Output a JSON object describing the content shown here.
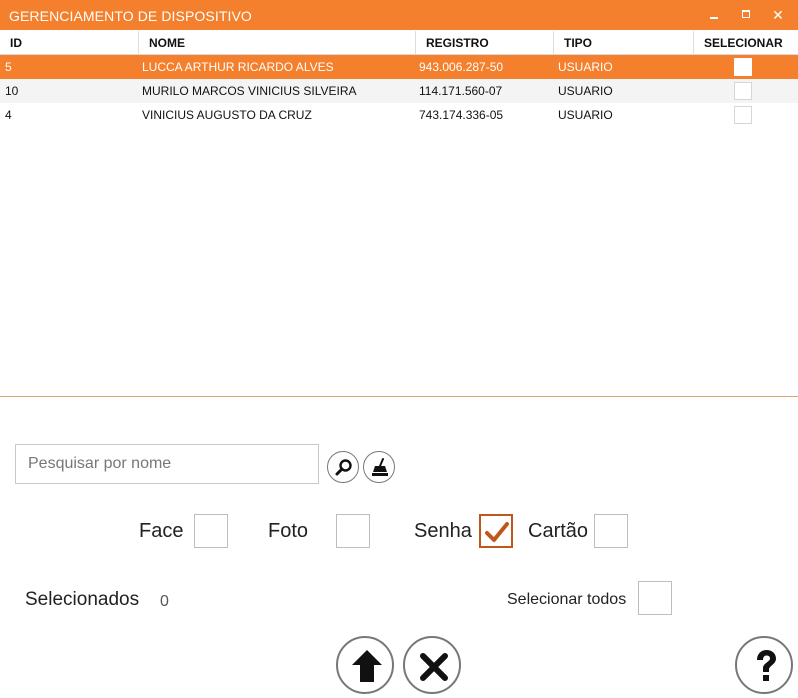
{
  "window": {
    "title": "GERENCIAMENTO DE DISPOSITIVO",
    "min_icon": "minimize-icon",
    "max_icon": "maximize-icon",
    "close_icon": "close-icon"
  },
  "table": {
    "columns": [
      "ID",
      "NOME",
      "REGISTRO",
      "TIPO",
      "SELECIONAR"
    ],
    "rows": [
      {
        "id": "5",
        "nome": "LUCCA ARTHUR RICARDO ALVES",
        "registro": "943.006.287-50",
        "tipo": "USUARIO",
        "selected": true
      },
      {
        "id": "10",
        "nome": "MURILO MARCOS VINICIUS SILVEIRA",
        "registro": "114.171.560-07",
        "tipo": "USUARIO",
        "selected": false
      },
      {
        "id": "4",
        "nome": "VINICIUS AUGUSTO DA CRUZ",
        "registro": "743.174.336-05",
        "tipo": "USUARIO",
        "selected": false
      }
    ]
  },
  "search": {
    "placeholder": "Pesquisar por nome",
    "value": "",
    "search_icon": "search-icon",
    "clear_icon": "broom-icon"
  },
  "options": {
    "face": {
      "label": "Face",
      "checked": false
    },
    "foto": {
      "label": "Foto",
      "checked": false
    },
    "senha": {
      "label": "Senha",
      "checked": true
    },
    "cartao": {
      "label": "Cartão",
      "checked": false
    }
  },
  "selection": {
    "label": "Selecionados",
    "count": "0",
    "select_all_label": "Selecionar todos",
    "select_all_checked": false
  },
  "actions": {
    "upload_icon": "arrow-up-icon",
    "cancel_icon": "x-icon",
    "help_icon": "question-icon"
  },
  "colors": {
    "accent": "#f47f2c",
    "check": "#c1561a",
    "divider": "#e0a46e"
  }
}
